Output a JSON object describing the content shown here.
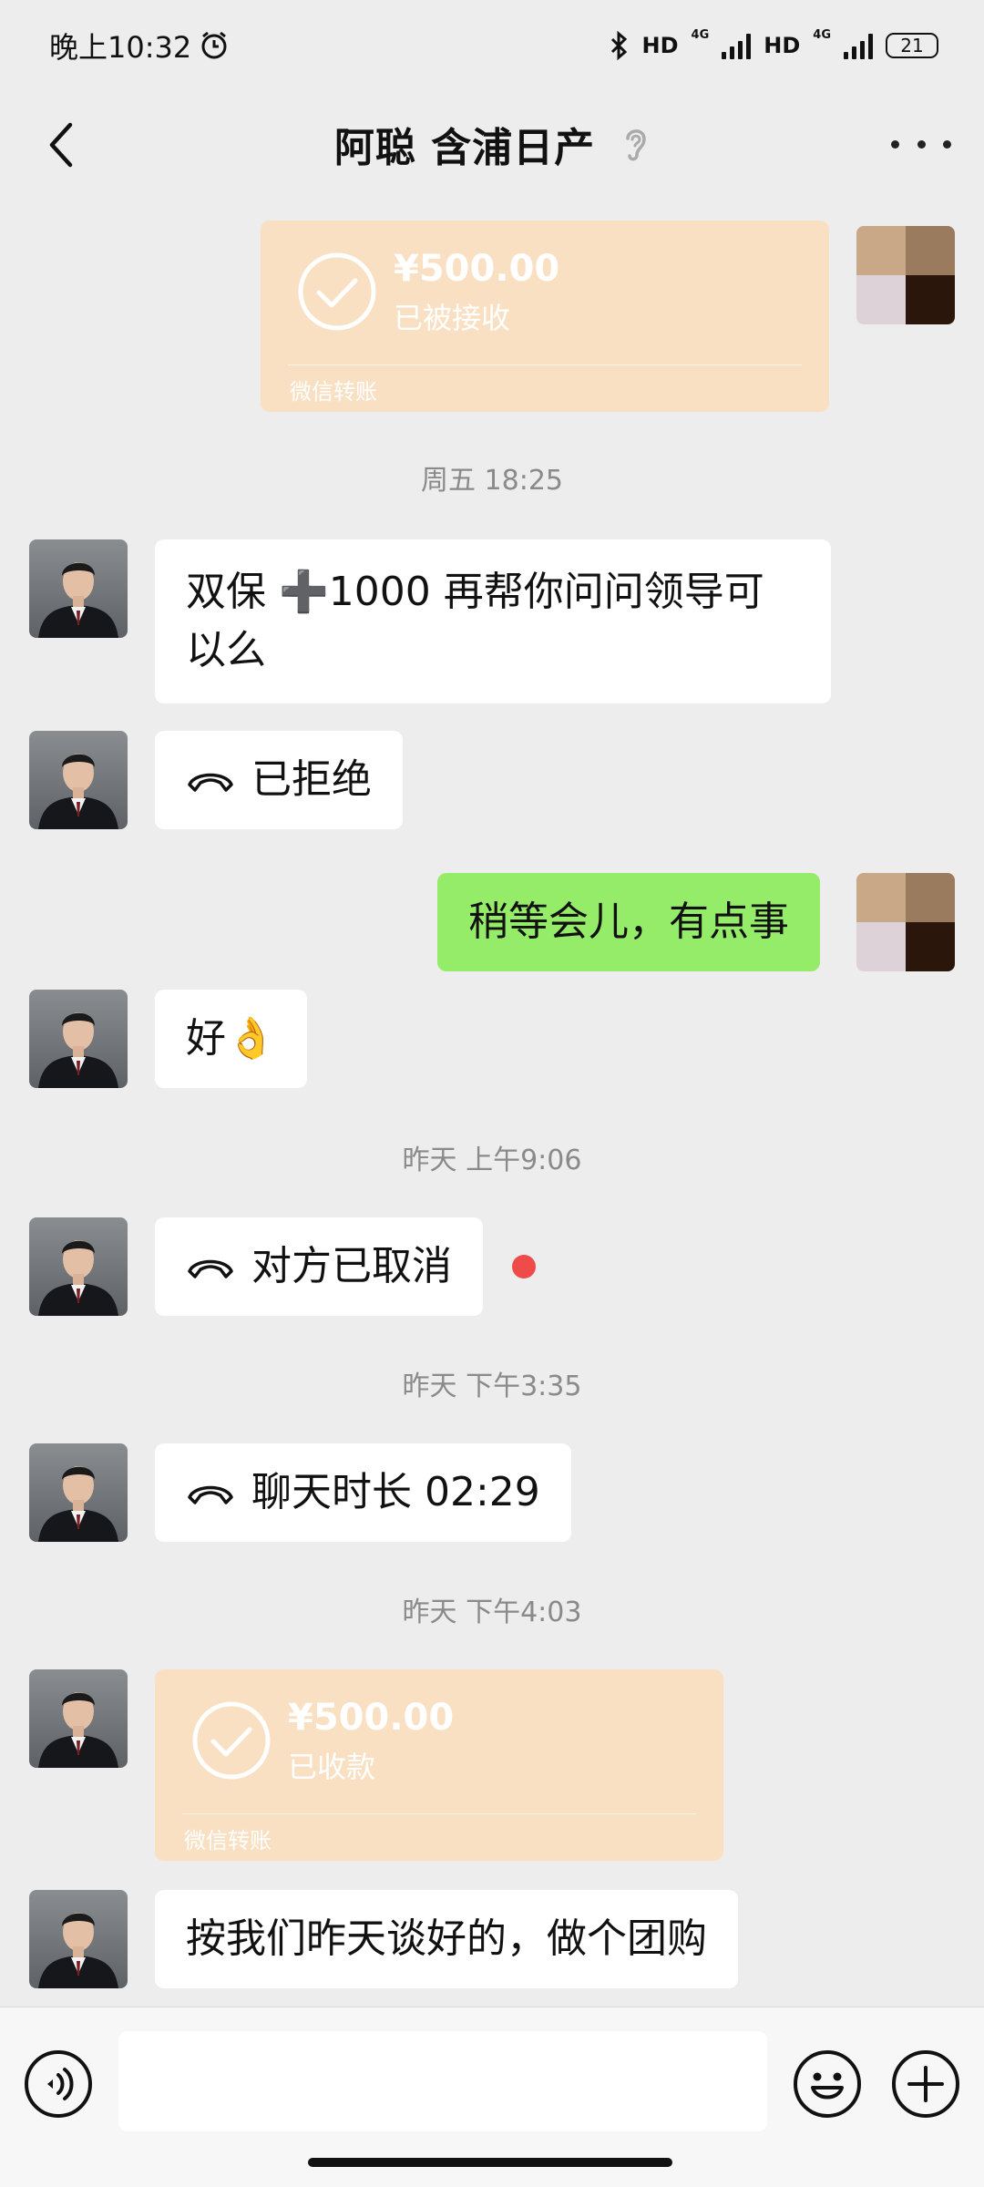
{
  "status_bar": {
    "time": "晚上10:32",
    "hd1": "HD",
    "net1": "4G",
    "hd2": "HD",
    "net2": "4G",
    "battery": "21"
  },
  "header": {
    "title": "阿聪 含浦日产"
  },
  "messages": {
    "transfer_sent": {
      "amount": "¥500.00",
      "status": "已被接收",
      "label": "微信转账"
    },
    "ts1": "周五 18:25",
    "msg_double": "双保 ➕1000 再帮你问问领导可以么",
    "call_rejected": "已拒绝",
    "msg_wait": "稍等会儿，有点事",
    "msg_ok": "好👌",
    "ts2": "昨天 上午9:06",
    "call_cancelled": "对方已取消",
    "ts3": "昨天 下午3:35",
    "call_duration": "聊天时长 02:29",
    "ts4": "昨天 下午4:03",
    "transfer_received": {
      "amount": "¥500.00",
      "status": "已收款",
      "label": "微信转账"
    },
    "msg_groupbuy": "按我们昨天谈好的，做个团购"
  },
  "input": {
    "placeholder": ""
  },
  "colors": {
    "background": "#ededed",
    "self_bubble": "#95ec69",
    "transfer_card": "#fae0c3",
    "unread_dot": "#f04b4b"
  }
}
